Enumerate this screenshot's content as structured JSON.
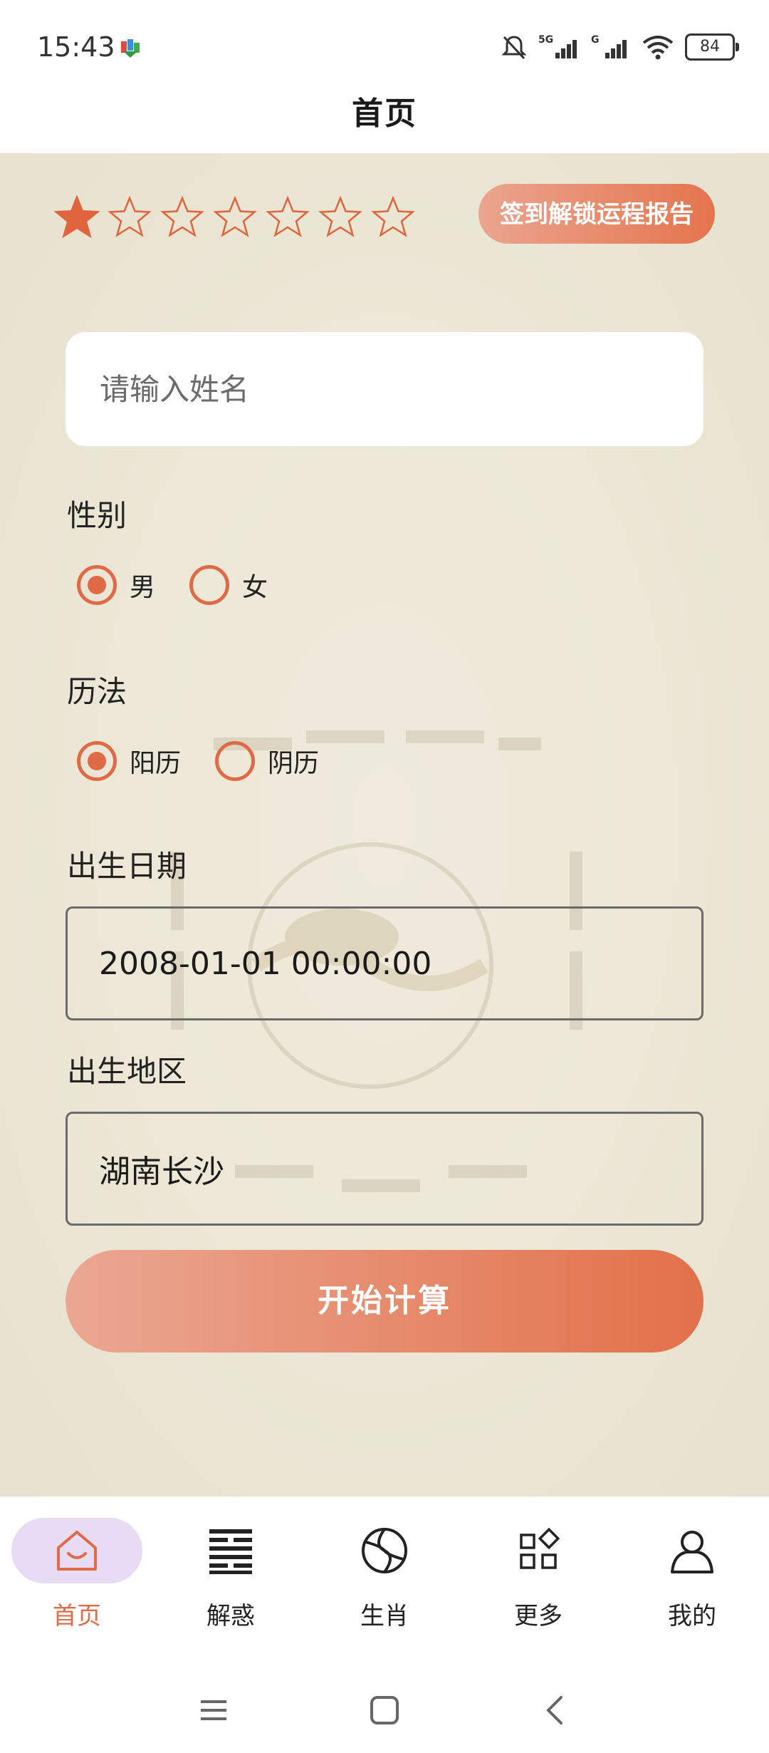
{
  "status_bar": {
    "time": "15:43",
    "battery": "84",
    "icons": [
      "app-notification-icon",
      "mute-icon",
      "signal-5g-icon",
      "signal-g-icon",
      "wifi-icon",
      "battery-icon"
    ]
  },
  "header": {
    "title": "首页"
  },
  "rating": {
    "filled": 1,
    "total": 7
  },
  "checkin_button": "签到解锁运程报告",
  "form": {
    "name_placeholder": "请输入姓名",
    "name_value": "",
    "gender_label": "性别",
    "gender_options": [
      "男",
      "女"
    ],
    "gender_selected": "男",
    "calendar_label": "历法",
    "calendar_options": [
      "阳历",
      "阴历"
    ],
    "calendar_selected": "阳历",
    "birth_date_label": "出生日期",
    "birth_date_value": "2008-01-01 00:00:00",
    "birth_region_label": "出生地区",
    "birth_region_value": "湖南长沙",
    "submit_label": "开始计算"
  },
  "bottom_nav": {
    "items": [
      {
        "label": "首页",
        "icon": "home-icon",
        "active": true
      },
      {
        "label": "解惑",
        "icon": "hexagram-icon",
        "active": false
      },
      {
        "label": "生肖",
        "icon": "zodiac-icon",
        "active": false
      },
      {
        "label": "更多",
        "icon": "grid-more-icon",
        "active": false
      },
      {
        "label": "我的",
        "icon": "profile-icon",
        "active": false
      }
    ]
  },
  "colors": {
    "accent": "#e06a45",
    "button_gradient_start": "#eaa792",
    "button_gradient_end": "#e2714a",
    "nav_active_bg": "#e8dcf4",
    "paper_bg": "#ece7d6"
  }
}
